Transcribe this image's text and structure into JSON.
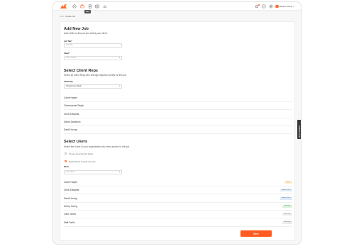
{
  "topbar": {
    "tooltip": "Jobs",
    "user_name": "Daniel Young"
  },
  "breadcrumb": {
    "parent": "Jobs",
    "separator": "/",
    "current": "Create Job"
  },
  "add_job": {
    "title": "Add New Job",
    "subtitle": "Add a title for this job and select your client.",
    "job_title_label": "Job Title*",
    "job_title_placeholder": "Job Title",
    "client_label": "Client*",
    "client_placeholder": "Client Name"
  },
  "client_reps": {
    "title": "Select Client Reps",
    "subtitle": "Select all Client Reps who will sign daywork sheets for this job.",
    "select_label": "Client Rep",
    "select_value": "Charanpreet Singh",
    "items": [
      "Caine Hayes",
      "Charanpreet Singh",
      "Chris Edwards",
      "David Jacobson",
      "David Young"
    ]
  },
  "users": {
    "title": "Select Users",
    "subtitle": "Select the Users in your organisation who need access to this job.",
    "radio_all": "All users can access this project",
    "radio_restrict": "Restrict access to select users only",
    "select_label": "Name",
    "select_placeholder": "User Name",
    "items": [
      {
        "name": "Caine Hayes",
        "role": "Admin",
        "bg": "#fde8c8",
        "fg": "#b8741a"
      },
      {
        "name": "Chris Edwards",
        "role": "Admin Officer",
        "bg": "#dde9f7",
        "fg": "#4a6f9a"
      },
      {
        "name": "David Young",
        "role": "Admin Officer",
        "bg": "#dde9f7",
        "fg": "#4a6f9a"
      },
      {
        "name": "Henry Young",
        "role": "Operative",
        "bg": "#d9f1dc",
        "fg": "#3d8a4a"
      },
      {
        "name": "John Jones",
        "role": "Read Only",
        "bg": "#ececec",
        "fg": "#666666"
      },
      {
        "name": "Matt Farlin",
        "role": "Read Only",
        "bg": "#ececec",
        "fg": "#666666"
      }
    ]
  },
  "save_label": "Save",
  "feedback_label": "Share feedback",
  "colors": {
    "accent": "#ff5a1f"
  }
}
